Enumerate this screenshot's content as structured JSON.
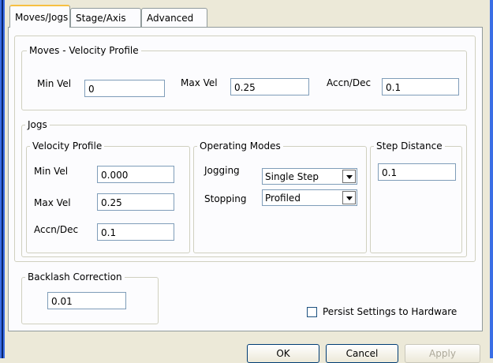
{
  "tabs": [
    {
      "label": "Moves/Jogs"
    },
    {
      "label": "Stage/Axis"
    },
    {
      "label": "Advanced"
    }
  ],
  "moves": {
    "title": "Moves - Velocity Profile",
    "min_vel_label": "Min Vel",
    "min_vel_value": "0",
    "max_vel_label": "Max Vel",
    "max_vel_value": "0.25",
    "accn_label": "Accn/Dec",
    "accn_value": "0.1"
  },
  "jogs": {
    "title": "Jogs",
    "velocity": {
      "title": "Velocity Profile",
      "min_vel_label": "Min Vel",
      "min_vel_value": "0.000",
      "max_vel_label": "Max Vel",
      "max_vel_value": "0.25",
      "accn_label": "Accn/Dec",
      "accn_value": "0.1"
    },
    "modes": {
      "title": "Operating Modes",
      "jogging_label": "Jogging",
      "jogging_value": "Single Step",
      "stopping_label": "Stopping",
      "stopping_value": "Profiled"
    },
    "step": {
      "title": "Step Distance",
      "value": "0.1"
    }
  },
  "backlash": {
    "title": "Backlash Correction",
    "value": "0.01"
  },
  "persist": {
    "label": "Persist Settings to Hardware",
    "checked": false
  },
  "buttons": {
    "ok": "OK",
    "cancel": "Cancel",
    "apply": "Apply"
  }
}
